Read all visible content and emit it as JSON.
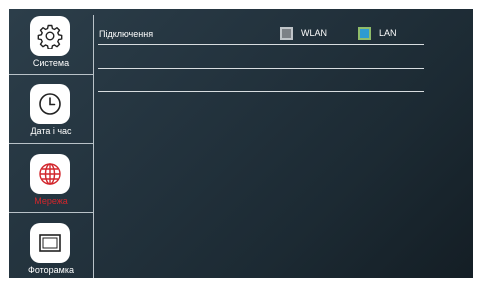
{
  "sidebar": {
    "items": [
      {
        "label": "Система",
        "icon": "gear-icon",
        "active": false
      },
      {
        "label": "Дата і час",
        "icon": "clock-icon",
        "active": false
      },
      {
        "label": "Мережа",
        "icon": "globe-icon",
        "active": true
      },
      {
        "label": "Фоторамка",
        "icon": "photo-frame-icon",
        "active": false
      }
    ]
  },
  "network": {
    "connection_label": "Підключення",
    "options": [
      {
        "label": "WLAN",
        "checked": false
      },
      {
        "label": "LAN",
        "checked": true
      }
    ]
  },
  "colors": {
    "active_label": "#d2262c",
    "checkbox_checked_fill": "#2e9bd0",
    "checkbox_checked_border": "#8fbc6a",
    "checkbox_unchecked_fill": "#7c8186"
  }
}
